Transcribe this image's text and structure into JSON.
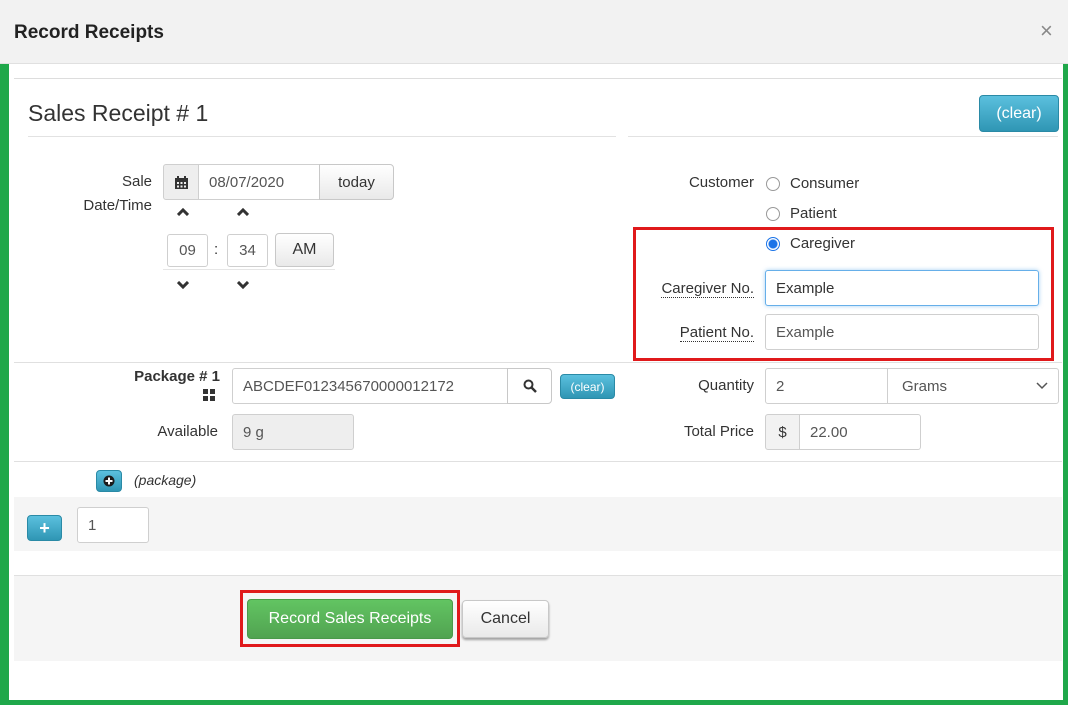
{
  "dialog": {
    "title": "Record Receipts",
    "close_icon": "×"
  },
  "receipt": {
    "heading": "Sales Receipt # 1",
    "clear_label": "(clear)"
  },
  "sale_datetime": {
    "label_line1": "Sale",
    "label_line2": "Date/Time",
    "date_value": "08/07/2020",
    "today_label": "today",
    "hour": "09",
    "colon": ":",
    "minute": "34",
    "ampm_label": "AM",
    "icons": [
      "calendar-icon",
      "chevron-up-icon",
      "chevron-down-icon"
    ]
  },
  "customer": {
    "label": "Customer",
    "options": [
      {
        "label": "Consumer",
        "checked": false
      },
      {
        "label": "Patient",
        "checked": false
      },
      {
        "label": "Caregiver",
        "checked": true
      }
    ],
    "caregiver_label": "Caregiver No.",
    "caregiver_value": "Example",
    "patient_label": "Patient No.",
    "patient_value": "Example"
  },
  "package": {
    "label": "Package # 1",
    "value": "ABCDEF012345670000012172",
    "clear_label": "(clear)",
    "available_label": "Available",
    "available_value": "9 g",
    "quantity_label": "Quantity",
    "quantity_value": "2",
    "unit_value": "Grams",
    "total_price_label": "Total Price",
    "currency_symbol": "$",
    "total_price_value": "22.00",
    "add_package_label": "(package)"
  },
  "receipts_count": {
    "add_symbol": "+",
    "value": "1"
  },
  "footer": {
    "record_label": "Record Sales Receipts",
    "cancel_label": "Cancel"
  },
  "colors": {
    "frame_green": "#1fa84a",
    "highlight_red": "#e0191b",
    "info_blue": "#5bc0de",
    "success_green": "#5cb85c"
  }
}
